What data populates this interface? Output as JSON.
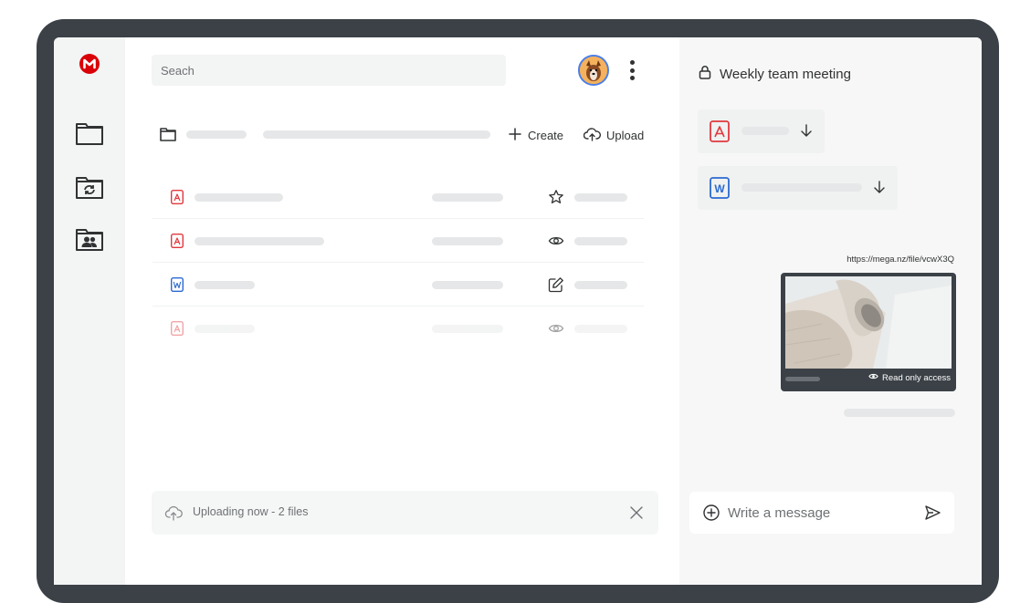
{
  "app": {
    "brand_color": "#d90007",
    "logo_icon": "mega-logo-icon"
  },
  "rail": {
    "items": [
      {
        "icon": "folder-icon"
      },
      {
        "icon": "sync-folder-icon"
      },
      {
        "icon": "shared-folder-icon"
      }
    ]
  },
  "search": {
    "placeholder": "Seach"
  },
  "toolbar": {
    "create_label": "Create",
    "upload_label": "Upload"
  },
  "files": [
    {
      "type": "pdf",
      "action_icon": "star-icon"
    },
    {
      "type": "pdf",
      "action_icon": "eye-icon"
    },
    {
      "type": "word",
      "action_icon": "edit-icon"
    },
    {
      "type": "pdf",
      "action_icon": "eye-icon"
    }
  ],
  "upload_status": {
    "text": "Uploading now - 2 files"
  },
  "chat": {
    "title": "Weekly team meeting",
    "link": "https://mega.nz/file/vcwX3Q",
    "preview_access": "Read only access",
    "composer_placeholder": "Write a message"
  },
  "colors": {
    "pdf": "#e0393e",
    "word": "#2b6ad1",
    "accent_blue": "#4b7ee8"
  }
}
